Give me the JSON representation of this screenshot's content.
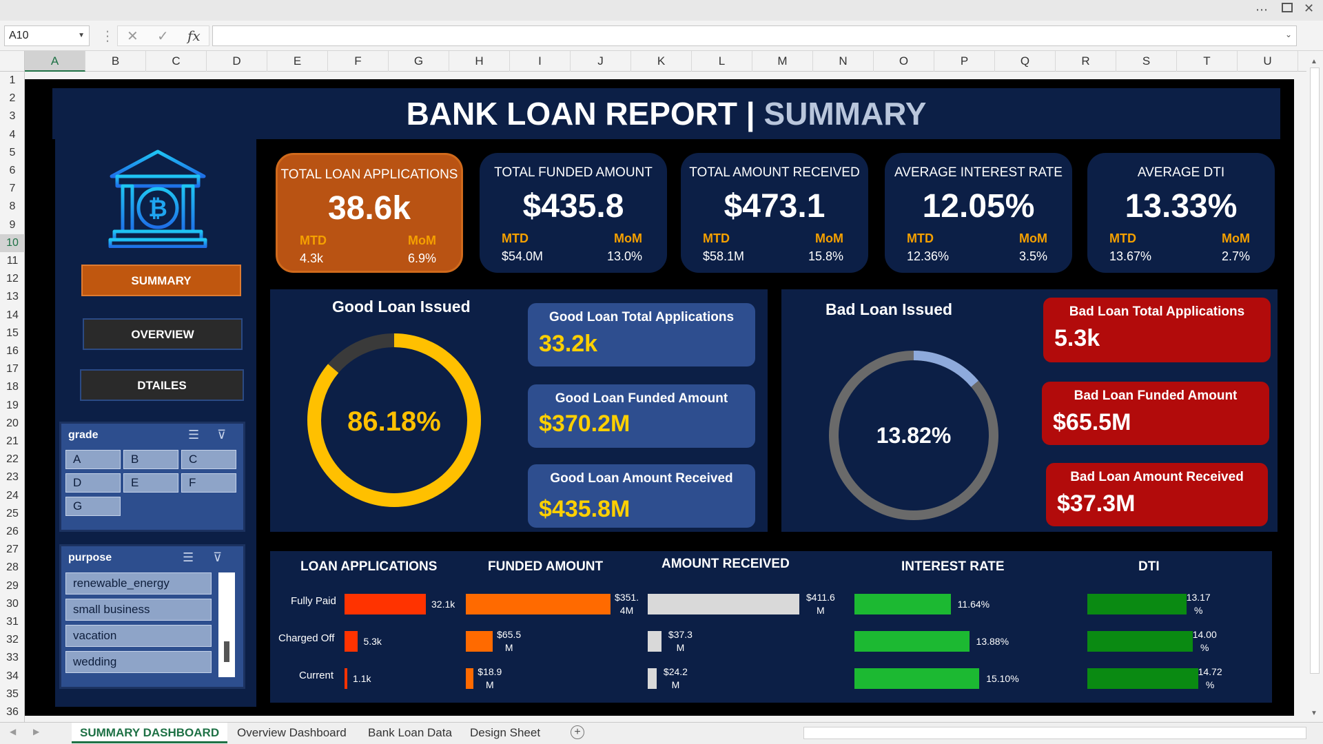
{
  "excel": {
    "name_box": "A10",
    "columns": [
      "A",
      "B",
      "C",
      "D",
      "E",
      "F",
      "G",
      "H",
      "I",
      "J",
      "K",
      "L",
      "M",
      "N",
      "O",
      "P",
      "Q",
      "R",
      "S",
      "T",
      "U"
    ],
    "rows": [
      "1",
      "2",
      "3",
      "4",
      "5",
      "6",
      "7",
      "8",
      "9",
      "10",
      "11",
      "12",
      "13",
      "14",
      "15",
      "16",
      "17",
      "18",
      "19",
      "20",
      "21",
      "22",
      "23",
      "24",
      "25",
      "26",
      "27",
      "28",
      "29",
      "30",
      "31",
      "32",
      "33",
      "34",
      "35",
      "36"
    ],
    "sheet_tabs": [
      "SUMMARY DASHBOARD",
      "Overview Dashboard",
      "Bank Loan Data",
      "Design Sheet"
    ],
    "active_tab": "SUMMARY DASHBOARD"
  },
  "header": {
    "title": "BANK LOAN REPORT | ",
    "subtitle": "SUMMARY"
  },
  "nav": {
    "summary": "SUMMARY",
    "overview": "OVERVIEW",
    "details": "DTAILES"
  },
  "slicers": {
    "grade": {
      "title": "grade",
      "items": [
        "A",
        "B",
        "C",
        "D",
        "E",
        "F",
        "G"
      ]
    },
    "purpose": {
      "title": "purpose",
      "items": [
        "renewable_energy",
        "small business",
        "vacation",
        "wedding"
      ]
    }
  },
  "kpis": [
    {
      "title": "TOTAL LOAN APPLICATIONS",
      "value": "38.6k",
      "mtd_label": "MTD",
      "mtd": "4.3k",
      "mom_label": "MoM",
      "mom": "6.9%",
      "color": "#b95313"
    },
    {
      "title": "TOTAL FUNDED AMOUNT",
      "value": "$435.8",
      "mtd_label": "MTD",
      "mtd": "$54.0M",
      "mom_label": "MoM",
      "mom": "13.0%",
      "color": "#0c1f46"
    },
    {
      "title": "TOTAL AMOUNT RECEIVED",
      "value": "$473.1",
      "mtd_label": "MTD",
      "mtd": "$58.1M",
      "mom_label": "MoM",
      "mom": "15.8%",
      "color": "#0c1f46"
    },
    {
      "title": "AVERAGE INTEREST RATE",
      "value": "12.05%",
      "mtd_label": "MTD",
      "mtd": "12.36%",
      "mom_label": "MoM",
      "mom": "3.5%",
      "color": "#0c1f46"
    },
    {
      "title": "AVERAGE DTI",
      "value": "13.33%",
      "mtd_label": "MTD",
      "mtd": "13.67%",
      "mom_label": "MoM",
      "mom": "2.7%",
      "color": "#0c1f46"
    }
  ],
  "good_loan": {
    "title": "Good Loan Issued",
    "percent_label": "86.18%",
    "fraction": 0.8618,
    "cards": [
      {
        "title": "Good Loan Total  Applications",
        "value": "33.2k"
      },
      {
        "title": "Good Loan Funded Amount",
        "value": "$370.2M"
      },
      {
        "title": "Good Loan Amount Received",
        "value": "$435.8M"
      }
    ]
  },
  "bad_loan": {
    "title": "Bad Loan Issued",
    "percent_label": "13.82%",
    "fraction": 0.1382,
    "cards": [
      {
        "title": "Bad Loan Total  Applications",
        "value": "5.3k"
      },
      {
        "title": "Bad Loan Funded Amount",
        "value": "$65.5M"
      },
      {
        "title": "Bad Loan Amount Received",
        "value": "$37.3M"
      }
    ]
  },
  "chart_data": [
    {
      "type": "bar",
      "title": "LOAN APPLICATIONS",
      "categories": [
        "Fully Paid",
        "Charged Off",
        "Current"
      ],
      "values": [
        32.1,
        5.3,
        1.1
      ],
      "labels": [
        "32.1k",
        "5.3k",
        "1.1k"
      ],
      "color": "#ff3300"
    },
    {
      "type": "bar",
      "title": "FUNDED AMOUNT",
      "categories": [
        "Fully Paid",
        "Charged Off",
        "Current"
      ],
      "values": [
        351.4,
        65.5,
        18.9
      ],
      "labels": [
        "$351.\n4M",
        "$65.5\nM",
        "$18.9\nM"
      ],
      "color": "#ff6a00"
    },
    {
      "type": "bar",
      "title": "AMOUNT RECEIVED",
      "categories": [
        "Fully Paid",
        "Charged Off",
        "Current"
      ],
      "values": [
        411.6,
        37.3,
        24.2
      ],
      "labels": [
        "$411.6\nM",
        "$37.3\nM",
        "$24.2\nM"
      ],
      "color": "#d9d9d9"
    },
    {
      "type": "bar",
      "title": "INTEREST RATE",
      "categories": [
        "Fully Paid",
        "Charged Off",
        "Current"
      ],
      "values": [
        11.64,
        13.88,
        15.1
      ],
      "labels": [
        "11.64%",
        "13.88%",
        "15.10%"
      ],
      "color": "#1cb932"
    },
    {
      "type": "bar",
      "title": "DTI",
      "categories": [
        "Fully Paid",
        "Charged Off",
        "Current"
      ],
      "values": [
        13.17,
        14.0,
        14.72
      ],
      "labels": [
        "13.17\n%",
        "14.00\n%",
        "14.72\n%"
      ],
      "color": "#0a8a12"
    }
  ]
}
